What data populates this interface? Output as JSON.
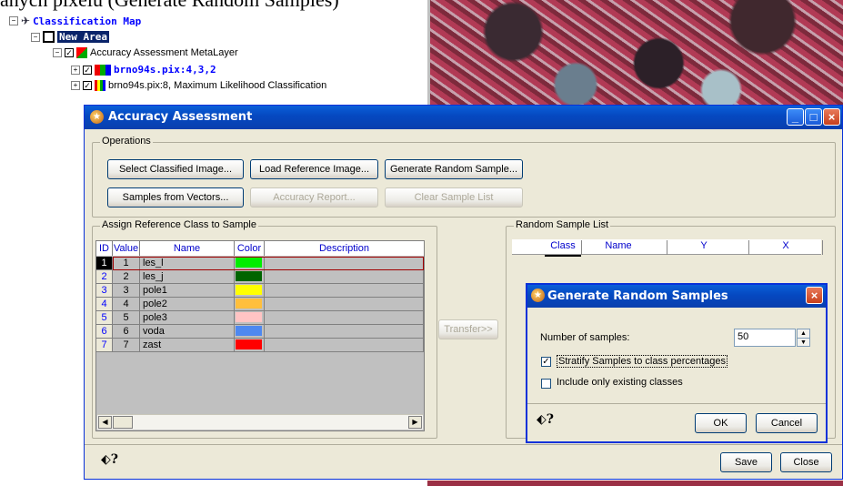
{
  "caption": "anych pixelu (Generate Random Samples)",
  "tree": {
    "root": "Classification Map",
    "new_area": "New Area",
    "metalayer": "Accuracy Assessment MetaLayer",
    "layer1": "brno94s.pix:4,3,2",
    "layer2": "brno94s.pix:8, Maximum Likelihood Classification"
  },
  "window": {
    "title": "Accuracy Assessment",
    "operations_label": "Operations",
    "buttons": {
      "select_classified": "Select Classified Image...",
      "load_reference": "Load Reference Image...",
      "generate_random": "Generate Random Sample...",
      "samples_from_vectors": "Samples from Vectors...",
      "accuracy_report": "Accuracy Report...",
      "clear_sample_list": "Clear Sample List",
      "transfer": "Transfer>>",
      "save": "Save",
      "close": "Close"
    },
    "assign_label": "Assign Reference Class to Sample",
    "table_headers": [
      "ID",
      "Value",
      "Name",
      "Color",
      "Description"
    ],
    "rows": [
      {
        "id": "1",
        "value": "1",
        "name": "les_l",
        "color": "#00ee00"
      },
      {
        "id": "2",
        "value": "2",
        "name": "les_j",
        "color": "#006400"
      },
      {
        "id": "3",
        "value": "3",
        "name": "pole1",
        "color": "#ffff00"
      },
      {
        "id": "4",
        "value": "4",
        "name": "pole2",
        "color": "#ffbf3c"
      },
      {
        "id": "5",
        "value": "5",
        "name": "pole3",
        "color": "#ffc4c4"
      },
      {
        "id": "6",
        "value": "6",
        "name": "voda",
        "color": "#4e88f0"
      },
      {
        "id": "7",
        "value": "7",
        "name": "zast",
        "color": "#ff0000"
      }
    ],
    "random_list_label": "Random Sample List",
    "random_headers": [
      "Class",
      "Name",
      "Y",
      "X"
    ]
  },
  "dialog": {
    "title": "Generate Random Samples",
    "num_samples_label": "Number of samples:",
    "num_samples_value": "50",
    "stratify_label": "Stratify Samples to class percentages",
    "stratify_checked": true,
    "existing_label": "Include only existing classes",
    "existing_checked": false,
    "ok": "OK",
    "cancel": "Cancel"
  }
}
